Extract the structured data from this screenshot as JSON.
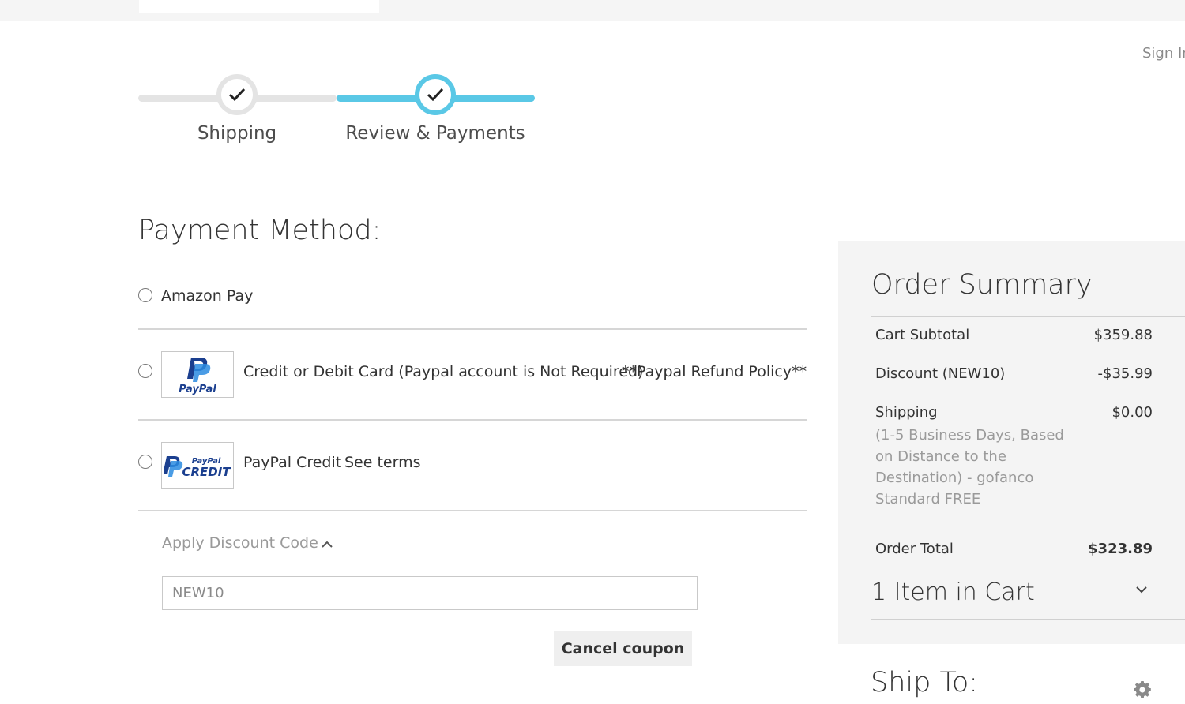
{
  "header": {
    "sign_in": "Sign In"
  },
  "progress": {
    "steps": [
      {
        "label": "Shipping",
        "completed": true
      },
      {
        "label": "Review & Payments",
        "completed": true,
        "active": true
      }
    ],
    "active_color": "#5ac8e6"
  },
  "payment": {
    "title": "Payment Method:",
    "methods": [
      {
        "label": "Amazon Pay",
        "selected": false
      },
      {
        "label": "Credit or Debit Card (Paypal account is Not Required)",
        "extra": "**Paypal Refund Policy**",
        "logo": "paypal-logo",
        "selected": false
      },
      {
        "label": "PayPal Credit",
        "extra": "See terms",
        "logo": "paypal-credit-logo",
        "selected": false
      }
    ]
  },
  "discount": {
    "title": "Apply Discount Code",
    "code_value": "NEW10",
    "cancel_label": "Cancel coupon"
  },
  "summary": {
    "title": "Order Summary",
    "rows": [
      {
        "label": "Cart Subtotal",
        "value": "$359.88"
      },
      {
        "label": "Discount (NEW10)",
        "value": "-$35.99"
      },
      {
        "label": "Shipping",
        "value": "$0.00"
      }
    ],
    "shipping_note": "(1-5 Business Days, Based on Distance to the Destination) - gofanco Standard FREE",
    "total_label": "Order Total",
    "total_value": "$323.89",
    "items_in_cart": "1 Item in Cart"
  },
  "ship_to": {
    "title": "Ship To:"
  },
  "logos": {
    "paypal_text": "PayPal",
    "credit_small": "PayPal",
    "credit_big": "CREDIT"
  }
}
